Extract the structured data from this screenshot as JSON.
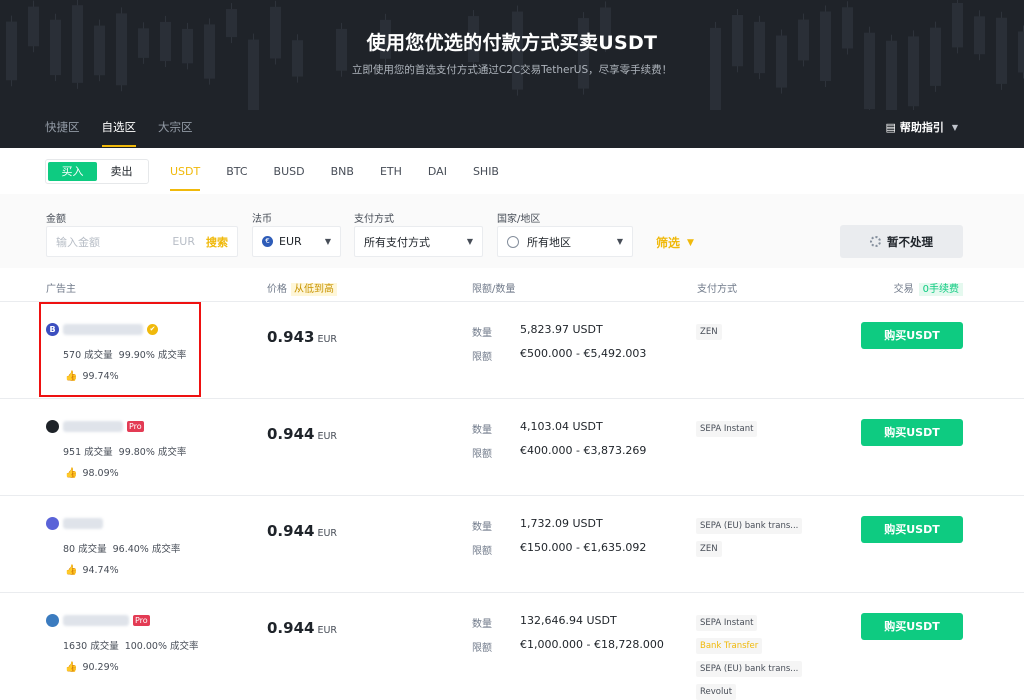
{
  "hero": {
    "title": "使用您优选的付款方式买卖USDT",
    "subtitle": "立即使用您的首选支付方式通过C2C交易TetherUS，尽享零手续费！"
  },
  "zone_tabs": [
    "快捷区",
    "自选区",
    "大宗区"
  ],
  "help": {
    "label": "帮助指引"
  },
  "trade_side": {
    "buy": "买入",
    "sell": "卖出"
  },
  "coins": [
    "USDT",
    "BTC",
    "BUSD",
    "BNB",
    "ETH",
    "DAI",
    "SHIB"
  ],
  "filters": {
    "amount_label": "金额",
    "amount_placeholder": "输入金额",
    "amount_currency": "EUR",
    "search_label": "搜索",
    "fiat_label": "法币",
    "fiat_value": "EUR",
    "fiat_icon": "€",
    "payment_label": "支付方式",
    "payment_value": "所有支付方式",
    "country_label": "国家/地区",
    "country_value": "所有地区",
    "filter_label": "筛选",
    "refresh_label": "暂不处理"
  },
  "table_header": {
    "advertiser": "广告主",
    "price": "价格",
    "price_sort": "从低到高",
    "limit": "限额/数量",
    "payment": "支付方式",
    "trade": "交易",
    "fee": "0手续费"
  },
  "rows": [
    {
      "avatar": "B",
      "avatar_color": "#3c4fbf",
      "badge": "verify",
      "orders": "570 成交量",
      "completion": "99.90% 成交率",
      "rating": "99.74%",
      "price": "0.943",
      "unit": "EUR",
      "qty_label": "数量",
      "qty": "5,823.97 USDT",
      "limit_label": "限额",
      "limit": "€500.000 - €5,492.003",
      "payments": [
        "ZEN"
      ],
      "button": "购买USDT"
    },
    {
      "avatar": "",
      "avatar_color": "#1e2329",
      "badge": "Pro",
      "orders": "951 成交量",
      "completion": "99.80% 成交率",
      "rating": "98.09%",
      "price": "0.944",
      "unit": "EUR",
      "qty_label": "数量",
      "qty": "4,103.04 USDT",
      "limit_label": "限额",
      "limit": "€400.000 - €3,873.269",
      "payments": [
        "SEPA Instant"
      ],
      "button": "购买USDT"
    },
    {
      "avatar": "",
      "avatar_color": "#5a63d8",
      "badge": "",
      "orders": "80 成交量",
      "completion": "96.40% 成交率",
      "rating": "94.74%",
      "price": "0.944",
      "unit": "EUR",
      "qty_label": "数量",
      "qty": "1,732.09 USDT",
      "limit_label": "限额",
      "limit": "€150.000 - €1,635.092",
      "payments": [
        "SEPA (EU) bank trans...",
        "ZEN"
      ],
      "button": "购买USDT"
    },
    {
      "avatar": "",
      "avatar_color": "#3b7bbf",
      "badge": "Pro",
      "orders": "1630 成交量",
      "completion": "100.00% 成交率",
      "rating": "90.29%",
      "price": "0.944",
      "unit": "EUR",
      "qty_label": "数量",
      "qty": "132,646.94 USDT",
      "limit_label": "限额",
      "limit": "€1,000.000 - €18,728.000",
      "payments": [
        "SEPA Instant",
        "Bank Transfer",
        "SEPA (EU) bank trans...",
        "Revolut"
      ],
      "button": "购买USDT"
    }
  ],
  "colors": {
    "accent": "#f0b90b",
    "buy": "#0ecb81",
    "hero_bg": "#1f2329",
    "highlight": "#ee1111"
  }
}
